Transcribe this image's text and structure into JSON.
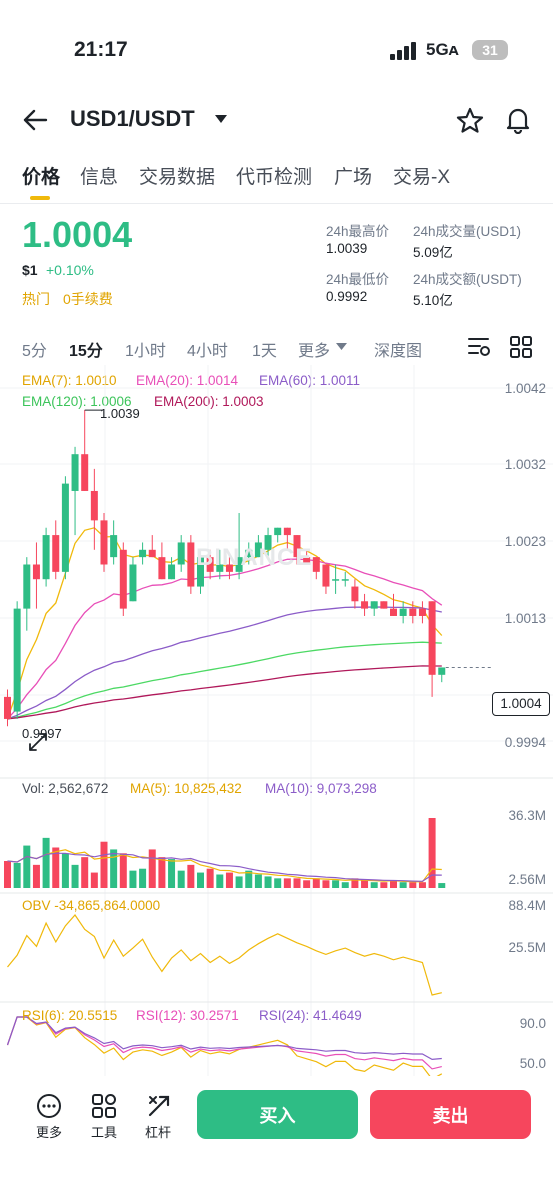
{
  "status": {
    "time": "21:17",
    "network": "5Gᴀ",
    "battery": "31"
  },
  "header": {
    "pair": "USD1/USDT"
  },
  "tabs": [
    "价格",
    "信息",
    "交易数据",
    "代币检测",
    "广场",
    "交易-X"
  ],
  "price": {
    "last": "1.0004",
    "fiat": "$1",
    "change": "+0.10%",
    "tag_hot": "热门",
    "tag_fee": "0手续费"
  },
  "stats": {
    "high_label": "24h最高价",
    "high_value": "1.0039",
    "vol_label": "24h成交量(USD1)",
    "vol_value": "5.09亿",
    "low_label": "24h最低价",
    "low_value": "0.9992",
    "turnover_label": "24h成交额(USDT)",
    "turnover_value": "5.10亿"
  },
  "timeframes": [
    "5分",
    "15分",
    "1小时",
    "4小时",
    "1天",
    "更多"
  ],
  "depth_label": "深度图",
  "indicators": {
    "ema7": "EMA(7): 1.0010",
    "ema20": "EMA(20): 1.0014",
    "ema60": "EMA(60): 1.0011",
    "ema120": "EMA(120): 1.0006",
    "ema200": "EMA(200): 1.0003"
  },
  "price_axis": [
    "1.0042",
    "1.0032",
    "1.0023",
    "1.0013",
    "1.0004",
    "0.9994"
  ],
  "annotations": {
    "high": "1.0039",
    "low": "0.9997",
    "current": "1.0004"
  },
  "watermark": "BINANCE",
  "volume": {
    "vol": "Vol: 2,562,672",
    "ma5": "MA(5): 10,825,432",
    "ma10": "MA(10): 9,073,298",
    "axis_top": "36.3M",
    "axis_bottom": "2.56M"
  },
  "obv": {
    "label": "OBV -34,865,864.0000",
    "axis_top": "88.4M",
    "axis_mid": "25.5M"
  },
  "rsi": {
    "rsi6": "RSI(6): 20.5515",
    "rsi12": "RSI(12): 30.2571",
    "rsi24": "RSI(24): 41.4649",
    "axis_top": "90.0",
    "axis_mid": "50.0"
  },
  "footer": {
    "more": "更多",
    "tools": "工具",
    "leverage": "杠杆",
    "buy": "买入",
    "sell": "卖出"
  },
  "colors": {
    "up": "#2ebd85",
    "down": "#f6465d",
    "ema7": "#f0b90b",
    "ema20": "#e84fb8",
    "ema60": "#8b5cc8",
    "ema120": "#4cd964",
    "ema200": "#b0185a"
  },
  "chart_data": {
    "type": "candlestick",
    "candles": [
      {
        "o": 1.0,
        "h": 1.0001,
        "l": 0.9996,
        "c": 0.9997
      },
      {
        "o": 0.9998,
        "h": 1.0013,
        "l": 0.9997,
        "c": 1.0012
      },
      {
        "o": 1.0012,
        "h": 1.0019,
        "l": 1.0009,
        "c": 1.0018
      },
      {
        "o": 1.0018,
        "h": 1.0021,
        "l": 1.0012,
        "c": 1.0016
      },
      {
        "o": 1.0016,
        "h": 1.0023,
        "l": 1.0015,
        "c": 1.0022
      },
      {
        "o": 1.0022,
        "h": 1.0024,
        "l": 1.0016,
        "c": 1.0017
      },
      {
        "o": 1.0017,
        "h": 1.003,
        "l": 1.0016,
        "c": 1.0029
      },
      {
        "o": 1.0028,
        "h": 1.0034,
        "l": 1.0022,
        "c": 1.0033
      },
      {
        "o": 1.0033,
        "h": 1.0039,
        "l": 1.0028,
        "c": 1.0028
      },
      {
        "o": 1.0028,
        "h": 1.0031,
        "l": 1.002,
        "c": 1.0024
      },
      {
        "o": 1.0024,
        "h": 1.0025,
        "l": 1.0017,
        "c": 1.0018
      },
      {
        "o": 1.0019,
        "h": 1.0024,
        "l": 1.0018,
        "c": 1.0022
      },
      {
        "o": 1.002,
        "h": 1.0021,
        "l": 1.0011,
        "c": 1.0012
      },
      {
        "o": 1.0013,
        "h": 1.0019,
        "l": 1.0013,
        "c": 1.0018
      },
      {
        "o": 1.0019,
        "h": 1.0021,
        "l": 1.0018,
        "c": 1.002
      },
      {
        "o": 1.002,
        "h": 1.0022,
        "l": 1.0019,
        "c": 1.0019
      },
      {
        "o": 1.0019,
        "h": 1.0021,
        "l": 1.0016,
        "c": 1.0016
      },
      {
        "o": 1.0016,
        "h": 1.0019,
        "l": 1.0016,
        "c": 1.0018
      },
      {
        "o": 1.0018,
        "h": 1.0022,
        "l": 1.0017,
        "c": 1.0021
      },
      {
        "o": 1.0021,
        "h": 1.0022,
        "l": 1.0014,
        "c": 1.0015
      },
      {
        "o": 1.0015,
        "h": 1.002,
        "l": 1.0014,
        "c": 1.0019
      },
      {
        "o": 1.0019,
        "h": 1.002,
        "l": 1.0016,
        "c": 1.0017
      },
      {
        "o": 1.0017,
        "h": 1.002,
        "l": 1.0016,
        "c": 1.0018
      },
      {
        "o": 1.0018,
        "h": 1.0019,
        "l": 1.0016,
        "c": 1.0017
      },
      {
        "o": 1.0017,
        "h": 1.0025,
        "l": 1.0016,
        "c": 1.0019
      },
      {
        "o": 1.0019,
        "h": 1.0021,
        "l": 1.0018,
        "c": 1.002
      },
      {
        "o": 1.0019,
        "h": 1.0022,
        "l": 1.0019,
        "c": 1.0021
      },
      {
        "o": 1.002,
        "h": 1.0023,
        "l": 1.0019,
        "c": 1.0022
      },
      {
        "o": 1.0022,
        "h": 1.0023,
        "l": 1.0021,
        "c": 1.0023
      },
      {
        "o": 1.0023,
        "h": 1.0023,
        "l": 1.002,
        "c": 1.0022
      },
      {
        "o": 1.0022,
        "h": 1.0022,
        "l": 1.0018,
        "c": 1.0019
      },
      {
        "o": 1.0019,
        "h": 1.002,
        "l": 1.0018,
        "c": 1.0018
      },
      {
        "o": 1.0019,
        "h": 1.0019,
        "l": 1.0016,
        "c": 1.0017
      },
      {
        "o": 1.0018,
        "h": 1.0018,
        "l": 1.0014,
        "c": 1.0015
      },
      {
        "o": 1.0016,
        "h": 1.0018,
        "l": 1.0014,
        "c": 1.0016
      },
      {
        "o": 1.0016,
        "h": 1.0017,
        "l": 1.0015,
        "c": 1.0016
      },
      {
        "o": 1.0015,
        "h": 1.0016,
        "l": 1.0012,
        "c": 1.0013
      },
      {
        "o": 1.0013,
        "h": 1.0014,
        "l": 1.0011,
        "c": 1.0012
      },
      {
        "o": 1.0012,
        "h": 1.0013,
        "l": 1.0011,
        "c": 1.0013
      },
      {
        "o": 1.0013,
        "h": 1.0013,
        "l": 1.0012,
        "c": 1.0012
      },
      {
        "o": 1.0012,
        "h": 1.0014,
        "l": 1.0011,
        "c": 1.0011
      },
      {
        "o": 1.0011,
        "h": 1.0013,
        "l": 1.001,
        "c": 1.0012
      },
      {
        "o": 1.0012,
        "h": 1.0013,
        "l": 1.001,
        "c": 1.0011
      },
      {
        "o": 1.0012,
        "h": 1.0013,
        "l": 1.001,
        "c": 1.0011
      },
      {
        "o": 1.0013,
        "h": 1.0013,
        "l": 1.0,
        "c": 1.0003
      },
      {
        "o": 1.0003,
        "h": 1.0004,
        "l": 1.0002,
        "c": 1.0004
      }
    ],
    "volumes_m": [
      14,
      13,
      22,
      12,
      26,
      21,
      18,
      12,
      16,
      8,
      24,
      20,
      18,
      9,
      10,
      20,
      16,
      15,
      9,
      12,
      8,
      10,
      7,
      8,
      6,
      9,
      7,
      6,
      5,
      5,
      5,
      4,
      5,
      4,
      4,
      3,
      5,
      4,
      3,
      3,
      4,
      3,
      3,
      3,
      36.3,
      2.56
    ]
  }
}
